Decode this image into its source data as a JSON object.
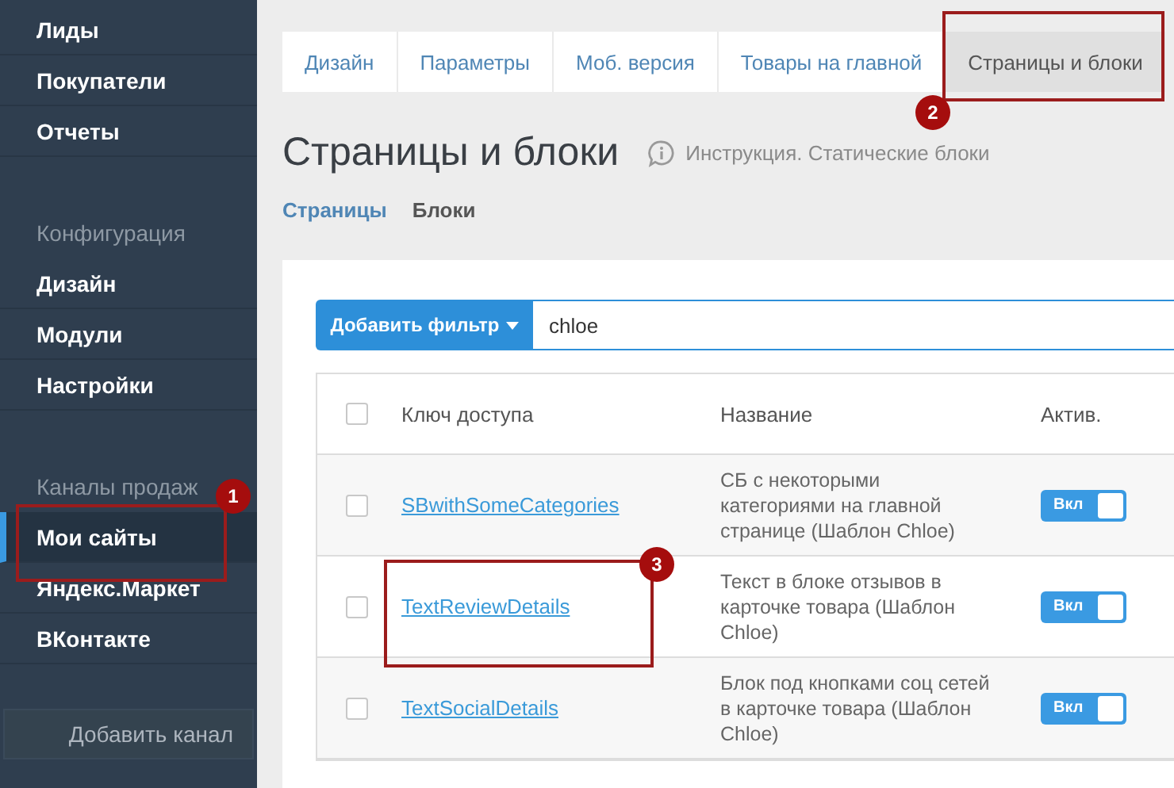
{
  "sidebar": {
    "sections": [
      {
        "items": [
          {
            "label": "Лиды",
            "selected": false
          },
          {
            "label": "Покупатели",
            "selected": false
          },
          {
            "label": "Отчеты",
            "selected": false
          }
        ]
      },
      {
        "label": "Конфигурация",
        "items": [
          {
            "label": "Дизайн",
            "selected": false
          },
          {
            "label": "Модули",
            "selected": false
          },
          {
            "label": "Настройки",
            "selected": false
          }
        ]
      },
      {
        "label": "Каналы продаж",
        "items": [
          {
            "label": "Мои сайты",
            "selected": true
          },
          {
            "label": "Яндекс.Маркет",
            "selected": false
          },
          {
            "label": "ВКонтакте",
            "selected": false
          }
        ]
      }
    ],
    "add_button": "Добавить канал"
  },
  "tabs": [
    {
      "label": "Дизайн",
      "selected": false
    },
    {
      "label": "Параметры",
      "selected": false
    },
    {
      "label": "Моб. версия",
      "selected": false
    },
    {
      "label": "Товары на главной",
      "selected": false
    },
    {
      "label": "Страницы и блоки",
      "selected": true
    }
  ],
  "page_title": "Страницы и блоки",
  "help_link": "Инструкция. Статические блоки",
  "subtabs": [
    {
      "label": "Страницы",
      "selected": false
    },
    {
      "label": "Блоки",
      "selected": true
    }
  ],
  "filter": {
    "button": "Добавить фильтр",
    "value": "chloe"
  },
  "table": {
    "columns": [
      "Ключ доступа",
      "Название",
      "Актив."
    ],
    "header_checked": false,
    "rows": [
      {
        "checked": false,
        "key": "SBwithSomeCategories",
        "name": "СБ с некоторыми категориями на главной странице (Шаблон Chloe)",
        "active": {
          "label": "Вкл",
          "on": true
        }
      },
      {
        "checked": false,
        "key": "TextReviewDetails",
        "name": "Текст в блоке отзывов в карточке товара (Шаблон Chloe)",
        "active": {
          "label": "Вкл",
          "on": true
        }
      },
      {
        "checked": false,
        "key": "TextSocialDetails",
        "name": "Блок под кнопками соц сетей в карточке товара (Шаблон Chloe)",
        "active": {
          "label": "Вкл",
          "on": true
        }
      }
    ]
  },
  "annotations": [
    {
      "number": "1"
    },
    {
      "number": "2"
    },
    {
      "number": "3"
    }
  ]
}
